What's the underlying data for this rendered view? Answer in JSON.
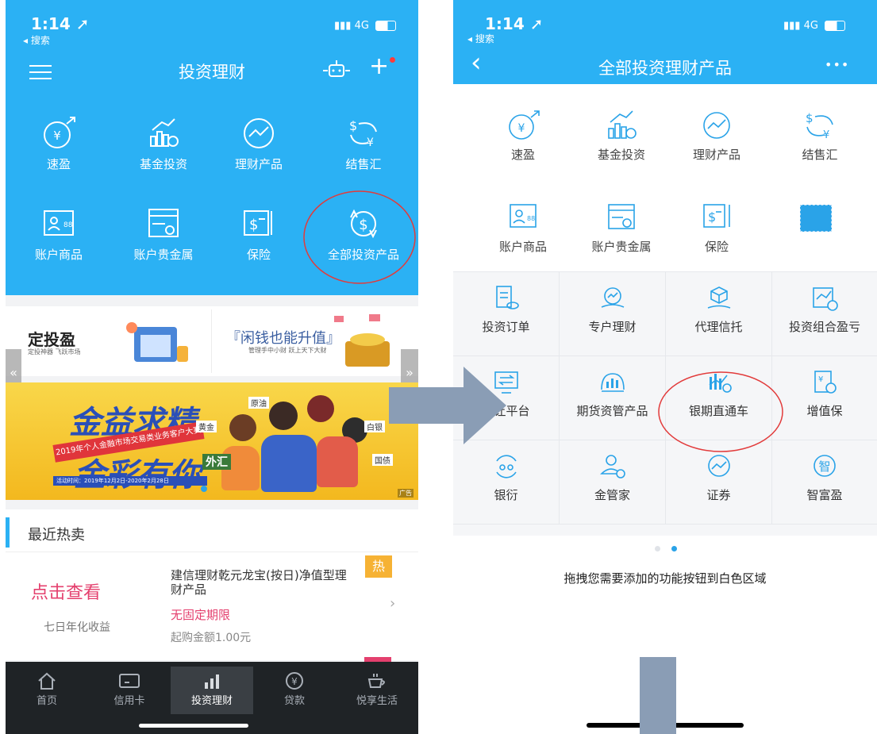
{
  "left": {
    "status": {
      "time": "1:14 ➚",
      "back": "◂ 搜索",
      "network": "4G"
    },
    "title": "投资理财",
    "menu_icon": "hamburger-icon",
    "robot_icon": "robot-icon",
    "plus_label": "+",
    "grid": [
      {
        "label": "速盈",
        "icon": "yen-arrow-icon"
      },
      {
        "label": "基金投资",
        "icon": "fund-chart-icon"
      },
      {
        "label": "理财产品",
        "icon": "trend-circle-icon"
      },
      {
        "label": "结售汇",
        "icon": "exchange-icon"
      },
      {
        "label": "账户商品",
        "icon": "account-card-icon"
      },
      {
        "label": "账户贵金属",
        "icon": "metal-card-icon"
      },
      {
        "label": "保险",
        "icon": "insurance-icon"
      },
      {
        "label": "全部投资产品",
        "icon": "dollar-refresh-icon"
      }
    ],
    "promo": {
      "left_title": "定投盈",
      "left_sub": "定投神器 飞跃市场",
      "right_title": "『闲钱也能升值』",
      "right_sub": "管理手中小财  跃上天下大财"
    },
    "banner": {
      "line1": "金益求精",
      "line2": "金彩有你",
      "ribbon": "2019年个人金融市场交易类业务客户大赛",
      "date": "活动时间：2019年12月2日-2020年2月28日",
      "tags": [
        "原油",
        "黄金",
        "白银",
        "外汇",
        "国债"
      ],
      "corner": "广告"
    },
    "section_title": "最近热卖",
    "product": {
      "cta": "点击查看",
      "cta_sub": "七日年化收益",
      "name": "建信理财乾元龙宝(按日)净值型理财产品",
      "term": "无固定期限",
      "min": "起购金额1.00元",
      "badge": "热"
    },
    "tabs": [
      {
        "label": "首页",
        "icon": "home-icon"
      },
      {
        "label": "信用卡",
        "icon": "card-icon"
      },
      {
        "label": "投资理财",
        "icon": "bar-chart-icon"
      },
      {
        "label": "贷款",
        "icon": "yen-circle-icon"
      },
      {
        "label": "悦享生活",
        "icon": "cup-icon"
      }
    ]
  },
  "right": {
    "status": {
      "time": "1:14 ➚",
      "back": "◂ 搜索",
      "network": "4G"
    },
    "title": "全部投资理财产品",
    "back_icon": "back-chevron-icon",
    "more_label": "•••",
    "grid": [
      {
        "label": "速盈",
        "icon": "yen-arrow-icon"
      },
      {
        "label": "基金投资",
        "icon": "fund-chart-icon"
      },
      {
        "label": "理财产品",
        "icon": "trend-circle-icon"
      },
      {
        "label": "结售汇",
        "icon": "exchange-icon"
      },
      {
        "label": "账户商品",
        "icon": "account-card-icon"
      },
      {
        "label": "账户贵金属",
        "icon": "metal-card-icon"
      },
      {
        "label": "保险",
        "icon": "insurance-icon"
      }
    ],
    "cells": [
      {
        "label": "投资订单",
        "icon": "order-icon"
      },
      {
        "label": "专户理财",
        "icon": "hand-chart-icon"
      },
      {
        "label": "代理信托",
        "icon": "cube-hand-icon"
      },
      {
        "label": "投资组合盈亏",
        "icon": "portfolio-icon"
      },
      {
        "label": "转让平台",
        "icon": "transfer-icon"
      },
      {
        "label": "期货资管产品",
        "icon": "futures-icon"
      },
      {
        "label": "银期直通车",
        "icon": "bank-futures-icon"
      },
      {
        "label": "增值保",
        "icon": "value-icon"
      },
      {
        "label": "银衍",
        "icon": "derivatives-icon"
      },
      {
        "label": "金管家",
        "icon": "butler-icon"
      },
      {
        "label": "证券",
        "icon": "securities-icon"
      },
      {
        "label": "智富盈",
        "icon": "zhi-icon"
      }
    ],
    "hint": "拖拽您需要添加的功能按钮到白色区域"
  },
  "colors": {
    "primary": "#29aaf0",
    "circle": "#e23b3b",
    "arrow": "#8a9db5",
    "hot": "#e4406e"
  }
}
